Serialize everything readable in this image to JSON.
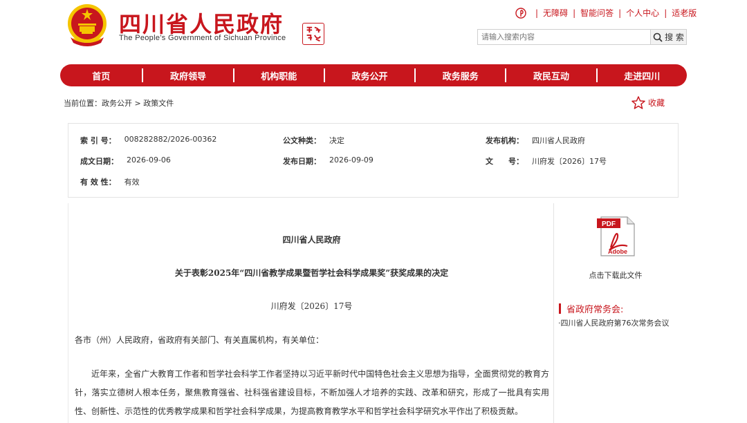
{
  "header": {
    "title": "四川省人民政府",
    "subtitle": "The People’s Government of Sichuan Province",
    "top_links": [
      "无障碍",
      "智能问答",
      "个人中心",
      "适老版"
    ],
    "search_placeholder": "请输入搜索内容",
    "search_button": "搜 索"
  },
  "nav": {
    "items": [
      "首页",
      "政府领导",
      "机构职能",
      "政务公开",
      "政务服务",
      "政民互动",
      "走进四川"
    ]
  },
  "breadcrumb": {
    "prefix": "当前位置：",
    "path": "政务公开 > 政策文件"
  },
  "favorite_label": "收藏",
  "info": {
    "index_label": "索 引 号：",
    "index_value": "008282882/2026-00362",
    "type_label": "公文种类：",
    "type_value": "决定",
    "publisher_label": "发布机构：",
    "publisher_value": "四川省人民政府",
    "created_label": "成文日期：",
    "created_value": "2026-09-06",
    "published_label": "发布日期：",
    "published_value": "2026-09-09",
    "docno_label": "文　　号：",
    "docno_value": "川府发〔2026〕17号",
    "validity_label": "有 效 性：",
    "validity_value": "有效"
  },
  "document": {
    "org": "四川省人民政府",
    "title": "关于表彰2025年“四川省教学成果暨哲学社会科学成果奖”获奖成果的决定",
    "number": "川府发〔2026〕17号",
    "salutation": "各市（州）人民政府，省政府有关部门、有关直属机构，有关单位：",
    "paragraph": "近年来，全省广大教育工作者和哲学社会科学工作者坚持以习近平新时代中国特色社会主义思想为指导，全面贯彻党的教育方针，落实立德树人根本任务，聚焦教育强省、社科强省建设目标，不断加强人才培养的实践、改革和研究，形成了一批具有实用性、创新性、示范性的优秀教学成果和哲学社会科学成果，为提高教育教学水平和哲学社会科学研究水平作出了积极贡献。"
  },
  "sidebar": {
    "pdf_label": "PDF",
    "adobe_label": "Adobe",
    "download_label": "点击下载此文件",
    "section_title": "省政府常务会:",
    "link": "·四川省人民政府第76次常务会议"
  },
  "colors": {
    "brand_red": "#c8161d",
    "emblem_gold": "#f5c400"
  }
}
